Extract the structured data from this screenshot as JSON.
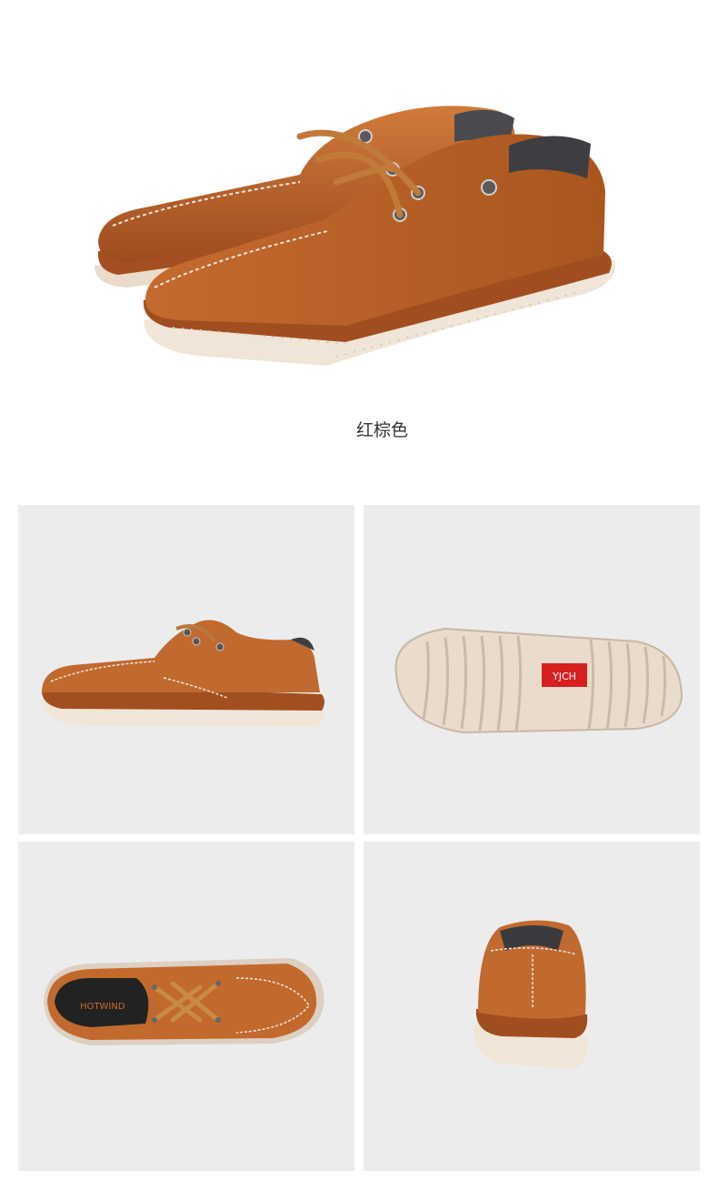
{
  "colors": {
    "leather": "#b5622a",
    "swatch": "#a8542a",
    "sole": "#efe2d4",
    "panel_bg": "#ececec"
  },
  "color_option": {
    "name": "红棕色"
  },
  "views": [
    {
      "name": "pair-three-quarter"
    },
    {
      "name": "side-view"
    },
    {
      "name": "outsole-view"
    },
    {
      "name": "top-view"
    },
    {
      "name": "back-view"
    }
  ],
  "brand_marks": {
    "outsole_logo": "YJCH",
    "insole_logo": "HOTWIND"
  }
}
